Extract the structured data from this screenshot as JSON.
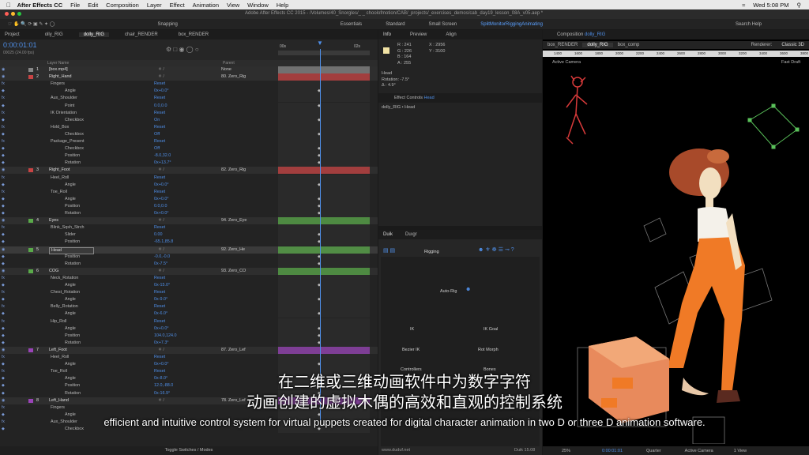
{
  "menubar": {
    "app": "After Effects CC",
    "items": [
      "File",
      "Edit",
      "Composition",
      "Layer",
      "Effect",
      "Animation",
      "View",
      "Window",
      "Help"
    ],
    "clock": "Wed 5:08 PM",
    "search": "Search Help"
  },
  "titlebar": {
    "text": "Adobe After Effects CC 2015 - /Volumes/40_Snorgles/_ _ choolofmotion/CAB/_projects/_exercises_demos/cab_day19_lesson_08A_v05.aep *"
  },
  "toolbar": {
    "snapping": "Snapping",
    "workspaces": [
      "Essentials",
      "Standard",
      "Small Screen",
      "SplitMonitorRiggingAnimating"
    ]
  },
  "timeline": {
    "tabs": [
      "Project",
      "olly_RIG",
      "dolly_RIG",
      "chair_RENDER",
      "box_RENDER"
    ],
    "timecode": "0:00:01:01",
    "fps": "00025 (24.00 fps)",
    "col_layer": "Layer Name",
    "col_parent": "Parent",
    "ruler": [
      "00s",
      "02s"
    ],
    "rows": [
      {
        "t": "layer",
        "n": "1",
        "name": "[box.mp4]",
        "parent": "None",
        "c": "#888"
      },
      {
        "t": "layer",
        "n": "2",
        "name": "Right_Hand",
        "parent": "80. Zero_Rig",
        "c": "#c94444"
      },
      {
        "t": "grp",
        "name": "Fingers",
        "val": "Reset"
      },
      {
        "t": "prop",
        "name": "Angle",
        "val": "0x+0.0°"
      },
      {
        "t": "grp",
        "name": "Aux_Shoulder",
        "val": "Reset"
      },
      {
        "t": "prop",
        "name": "Point",
        "val": "0.0,0.0"
      },
      {
        "t": "grp",
        "name": "IK Orientation",
        "val": "Reset"
      },
      {
        "t": "prop",
        "name": "Checkbox",
        "val": "On"
      },
      {
        "t": "grp",
        "name": "Hold_Box",
        "val": "Reset"
      },
      {
        "t": "prop",
        "name": "Checkbox",
        "val": "Off"
      },
      {
        "t": "grp",
        "name": "Package_Present",
        "val": "Reset"
      },
      {
        "t": "prop",
        "name": "Checkbox",
        "val": "Off"
      },
      {
        "t": "prop",
        "name": "Position",
        "val": "-8.0,32.0"
      },
      {
        "t": "prop",
        "name": "Rotation",
        "val": "0x+13.7°"
      },
      {
        "t": "layer",
        "n": "3",
        "name": "Right_Foot",
        "parent": "82. Zero_Rig",
        "c": "#c94444"
      },
      {
        "t": "grp",
        "name": "Heel_Roll",
        "val": "Reset"
      },
      {
        "t": "prop",
        "name": "Angle",
        "val": "0x+0.0°"
      },
      {
        "t": "grp",
        "name": "Toe_Roll",
        "val": "Reset"
      },
      {
        "t": "prop",
        "name": "Angle",
        "val": "0x+0.0°"
      },
      {
        "t": "prop",
        "name": "Position",
        "val": "0.0,0.0"
      },
      {
        "t": "prop",
        "name": "Rotation",
        "val": "0x+0.0°"
      },
      {
        "t": "layer",
        "n": "4",
        "name": "Eyes",
        "parent": "94. Zero_Eye",
        "c": "#5aaa4a"
      },
      {
        "t": "grp",
        "name": "Blink_Sqsh_Strch",
        "val": "Reset"
      },
      {
        "t": "prop",
        "name": "Slider",
        "val": "0.00"
      },
      {
        "t": "prop",
        "name": "Position",
        "val": "-65.1,85.8"
      },
      {
        "t": "layer",
        "n": "5",
        "name": "Head",
        "parent": "92. Zero_He",
        "c": "#5aaa4a",
        "sel": true
      },
      {
        "t": "prop",
        "name": "Position",
        "val": "-0.0,-0.0"
      },
      {
        "t": "prop",
        "name": "Rotation",
        "val": "0x-7.5°"
      },
      {
        "t": "layer",
        "n": "6",
        "name": "COG",
        "parent": "93. Zero_CO",
        "c": "#5aaa4a"
      },
      {
        "t": "grp",
        "name": "Neck_Rotation",
        "val": "Reset"
      },
      {
        "t": "prop",
        "name": "Angle",
        "val": "0x-15.0°"
      },
      {
        "t": "grp",
        "name": "Chest_Rotation",
        "val": "Reset"
      },
      {
        "t": "prop",
        "name": "Angle",
        "val": "0x-9.0°"
      },
      {
        "t": "grp",
        "name": "Belly_Rotation",
        "val": "Reset"
      },
      {
        "t": "prop",
        "name": "Angle",
        "val": "0x-6.0°"
      },
      {
        "t": "grp",
        "name": "Hip_Roll",
        "val": "Reset"
      },
      {
        "t": "prop",
        "name": "Angle",
        "val": "0x+0.0°"
      },
      {
        "t": "prop",
        "name": "Position",
        "val": "104.0,124.0"
      },
      {
        "t": "prop",
        "name": "Rotation",
        "val": "0x+7.3°"
      },
      {
        "t": "layer",
        "n": "7",
        "name": "Left_Foot",
        "parent": "87. Zero_Lef",
        "c": "#9a44b8"
      },
      {
        "t": "grp",
        "name": "Heel_Roll",
        "val": "Reset"
      },
      {
        "t": "prop",
        "name": "Angle",
        "val": "0x+0.0°"
      },
      {
        "t": "grp",
        "name": "Toe_Roll",
        "val": "Reset"
      },
      {
        "t": "prop",
        "name": "Angle",
        "val": "0x-8.0°"
      },
      {
        "t": "prop",
        "name": "Position",
        "val": "12.0,-88.0"
      },
      {
        "t": "prop",
        "name": "Rotation",
        "val": "0x-16.9°"
      },
      {
        "t": "layer",
        "n": "8",
        "name": "Left_Hand",
        "parent": "78. Zero_Lef",
        "c": "#9a44b8"
      },
      {
        "t": "grp",
        "name": "Fingers",
        "val": ""
      },
      {
        "t": "prop",
        "name": "Angle",
        "val": ""
      },
      {
        "t": "grp",
        "name": "Aux_Shoulder",
        "val": ""
      },
      {
        "t": "prop",
        "name": "Checkbox",
        "val": ""
      }
    ],
    "footer": "Toggle Switches / Modes"
  },
  "info": {
    "tabs": [
      "Info",
      "Preview",
      "Align"
    ],
    "r": "R : 241",
    "g": "G : 226",
    "b": "B : 164",
    "a": "A : 255",
    "x": "X : 2956",
    "y": "Y : 3100",
    "layer": "Head",
    "rotation": "Rotation: -7.5°",
    "delta": "Δ : 4.9°",
    "fx_tab": "Effect Controls",
    "fx_layer": "Head",
    "fx_path": "dolly_RIG • Head"
  },
  "duik": {
    "tabs": [
      "Duik",
      "Duıgr"
    ],
    "rigging": "Rigging",
    "autorig": "Auto-Rig",
    "ik": "IK",
    "ikgoal": "IK Goal",
    "bezier": "Bezier IK",
    "rotmorph": "Rot Morph",
    "controllers": "Controllers",
    "bones": "Bones",
    "url": "www.duduf.net",
    "version": "Duik 15.08"
  },
  "comp": {
    "title": "Composition",
    "comp_name": "dolly_RIG",
    "tabs": [
      "box_RENDER",
      "dolly_RIG",
      "box_comp"
    ],
    "renderer": "Renderer:",
    "renderer_val": "Classic 3D",
    "camera": "Active Camera",
    "draft": "Fast Draft",
    "ruler": [
      "1400",
      "1600",
      "1800",
      "2000",
      "2200",
      "2400",
      "2600",
      "2800",
      "3000",
      "3200",
      "3400",
      "3600",
      "3800"
    ],
    "zoom": "25%",
    "time": "0:00:01:01",
    "res": "Quarter",
    "view_cam": "Active Camera",
    "views": "1 View"
  },
  "subtitles": {
    "cn1": "在二维或三维动画软件中为数字字符",
    "cn2": "动画创建的虚拟木偶的高效和直观的控制系统",
    "en": "efficient and intuitive control system for virtual puppets created for digital character animation in two D or three D animation software."
  }
}
